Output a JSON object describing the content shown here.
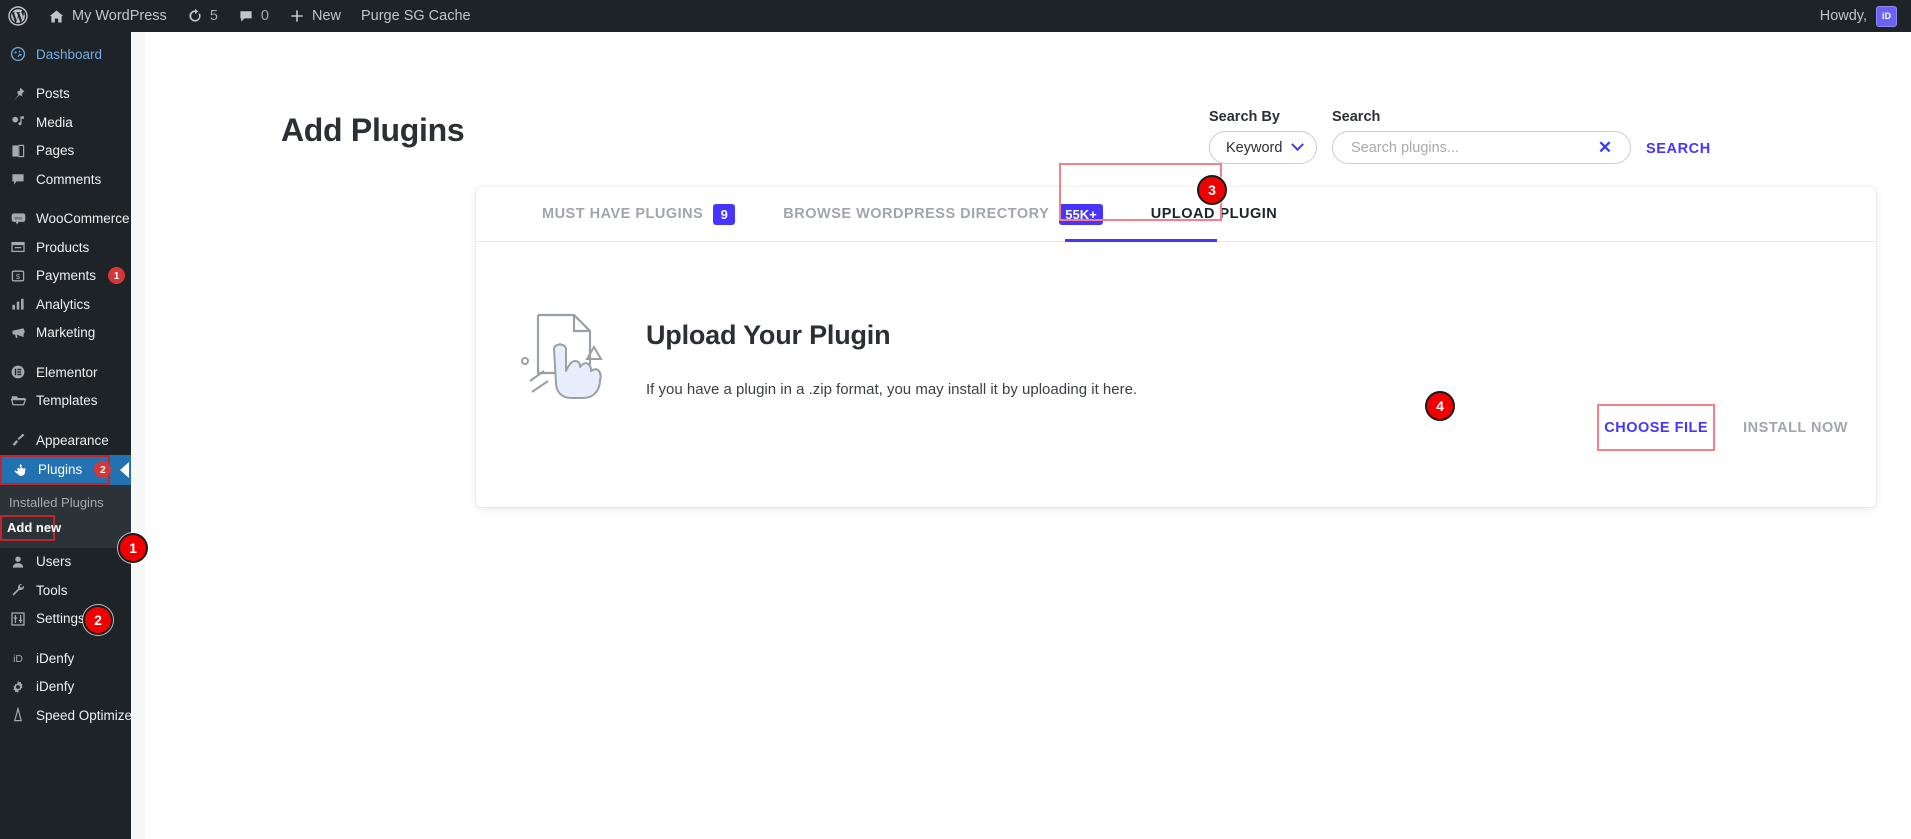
{
  "adminbar": {
    "items": [
      {
        "icon": "wordpress-logo-icon",
        "label": ""
      },
      {
        "icon": "home-icon",
        "label": "My WordPress"
      },
      {
        "icon": "updates-icon",
        "label": "5"
      },
      {
        "icon": "comments-icon",
        "label": "0"
      },
      {
        "icon": "plus-icon",
        "label": "New"
      },
      {
        "icon": "",
        "label": "Purge SG Cache"
      }
    ],
    "site_name": "My WordPress",
    "updates_count": "5",
    "comments_count": "0",
    "new_label": "New",
    "purge_label": "Purge SG Cache",
    "howdy_label": "Howdy,",
    "avatar_text": "iD"
  },
  "sidebar": {
    "items": [
      {
        "label": "Dashboard",
        "icon": "dashboard-icon",
        "current": true
      },
      {
        "label": "Posts",
        "icon": "pin-icon"
      },
      {
        "label": "Media",
        "icon": "media-icon"
      },
      {
        "label": "Pages",
        "icon": "pages-icon"
      },
      {
        "label": "Comments",
        "icon": "comment-icon"
      },
      {
        "label": "WooCommerce",
        "icon": "woo-icon"
      },
      {
        "label": "Products",
        "icon": "products-icon"
      },
      {
        "label": "Payments",
        "icon": "payments-icon",
        "badge": "1"
      },
      {
        "label": "Analytics",
        "icon": "analytics-icon"
      },
      {
        "label": "Marketing",
        "icon": "megaphone-icon"
      },
      {
        "label": "Elementor",
        "icon": "elementor-icon"
      },
      {
        "label": "Templates",
        "icon": "folder-icon"
      },
      {
        "label": "Appearance",
        "icon": "brush-icon"
      },
      {
        "label": "Plugins",
        "icon": "plug-icon",
        "badge": "2",
        "active": true
      },
      {
        "label": "Users",
        "icon": "user-icon"
      },
      {
        "label": "Tools",
        "icon": "wrench-icon"
      },
      {
        "label": "Settings",
        "icon": "sliders-icon"
      },
      {
        "label": "iDenfy",
        "icon": "idenfy-icon"
      },
      {
        "label": "iDenfy",
        "icon": "gear-icon"
      },
      {
        "label": "Speed Optimizer",
        "icon": "speed-icon"
      }
    ],
    "plugins": {
      "label": "Plugins",
      "badge": "2"
    },
    "submenu": [
      {
        "label": "Installed Plugins",
        "current": false
      },
      {
        "label": "Add new",
        "current": true
      }
    ]
  },
  "main": {
    "page_title": "Add Plugins",
    "search_by": {
      "label": "Search By",
      "value": "Keyword"
    },
    "search": {
      "label": "Search",
      "value": "",
      "placeholder": "Search plugins...",
      "clear_glyph": "✕",
      "button_label": "SEARCH"
    },
    "tabs": [
      {
        "label": "MUST HAVE PLUGINS",
        "badge": "9",
        "active": false
      },
      {
        "label": "BROWSE WORDPRESS DIRECTORY",
        "badge": "55K+",
        "active": false
      },
      {
        "label": "UPLOAD PLUGIN",
        "badge": "",
        "active": true
      }
    ],
    "upload": {
      "heading": "Upload Your Plugin",
      "description": "If you have a plugin in a .zip format, you may install it by uploading it here.",
      "choose_file_label": "CHOOSE FILE",
      "install_now_label": "INSTALL NOW"
    }
  },
  "markers": [
    {
      "number": "1",
      "target": "sidebar-item-plugins"
    },
    {
      "number": "2",
      "target": "submenu-add-new"
    },
    {
      "number": "3",
      "target": "tab-upload-plugin"
    },
    {
      "number": "4",
      "target": "choose-file-button"
    }
  ],
  "colors": {
    "admin_dark": "#1d2327",
    "accent_blue": "#4535ff",
    "active_menu_blue": "#2271b1",
    "badge_red": "#d63638",
    "marker_red": "#f00000",
    "highlight_border": "#c0272d",
    "tab_highlight_border": "#f4818a"
  }
}
